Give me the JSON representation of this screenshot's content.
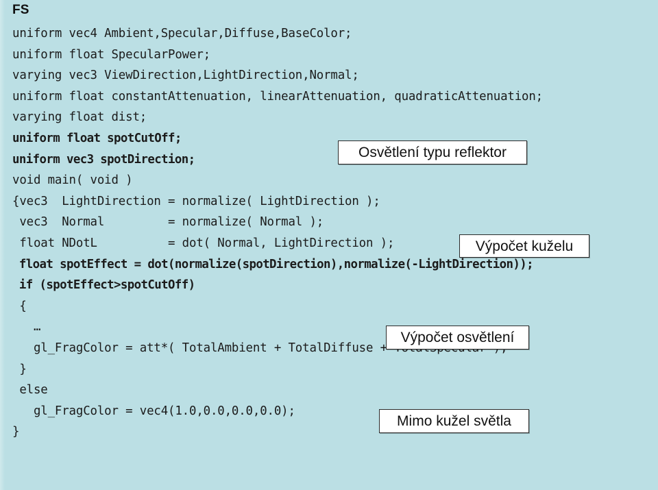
{
  "slide": {
    "title": "FS",
    "background_color": "#bbdfe4",
    "text_color": "#1b1b1b",
    "callout_bg_color": "#ffffff",
    "callout_border_color": "#2b2b2b"
  },
  "code": {
    "language": "glsl",
    "lines": [
      {
        "text": "uniform vec4 Ambient,Specular,Diffuse,BaseColor;",
        "bold": false
      },
      {
        "text": "uniform float SpecularPower;",
        "bold": false
      },
      {
        "text": "varying vec3 ViewDirection,LightDirection,Normal;",
        "bold": false
      },
      {
        "text": "uniform float constantAttenuation, linearAttenuation, quadraticAttenuation;",
        "bold": false
      },
      {
        "text": "varying float dist;",
        "bold": false
      },
      {
        "text": "uniform float spotCutOff;",
        "bold": true
      },
      {
        "text": "uniform vec3 spotDirection;",
        "bold": true
      },
      {
        "text": "void main( void )",
        "bold": false
      },
      {
        "text": "{vec3  LightDirection = normalize( LightDirection );",
        "bold": false
      },
      {
        "text": " vec3  Normal         = normalize( Normal );",
        "bold": false
      },
      {
        "text": " float NDotL          = dot( Normal, LightDirection );",
        "bold": false
      },
      {
        "text": " float spotEffect = dot(normalize(spotDirection),normalize(-LightDirection));",
        "bold": true
      },
      {
        "text": " if (spotEffect>spotCutOff)",
        "bold": true
      },
      {
        "text": " {",
        "bold": false
      },
      {
        "text": "   …",
        "bold": false
      },
      {
        "text": "   gl_FragColor = att*( TotalAmbient + TotalDiffuse + TotalSpecular );",
        "bold": false
      },
      {
        "text": " }",
        "bold": false
      },
      {
        "text": " else",
        "bold": false
      },
      {
        "text": "   gl_FragColor = vec4(1.0,0.0,0.0,0.0);",
        "bold": false
      },
      {
        "text": "}",
        "bold": false
      }
    ]
  },
  "callouts": [
    {
      "label": "Osvětlení typu reflektor"
    },
    {
      "label": "Výpočet kuželu"
    },
    {
      "label": "Výpočet osvětlení"
    },
    {
      "label": "Mimo kužel světla"
    }
  ]
}
